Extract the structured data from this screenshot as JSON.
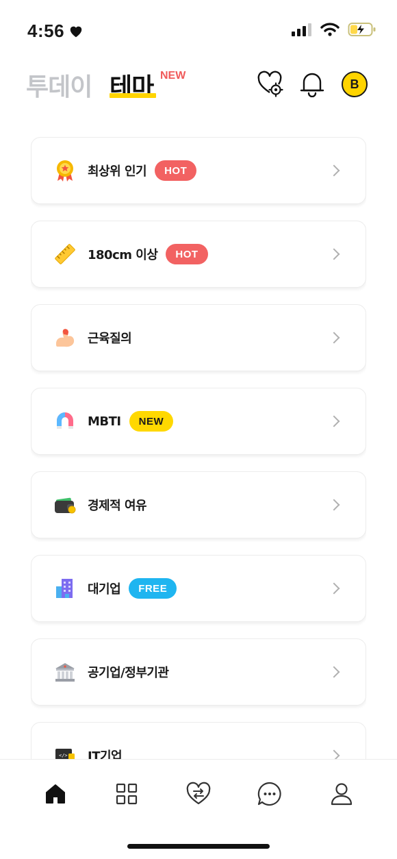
{
  "status_bar": {
    "time": "4:56"
  },
  "header": {
    "tab_today": "투데이",
    "tab_theme": "테마",
    "tab_theme_badge": "NEW",
    "avatar_letter": "B"
  },
  "themes": [
    {
      "label": "최상위 인기",
      "badge": "HOT",
      "badge_type": "hot",
      "icon": "medal-icon"
    },
    {
      "label": "180cm 이상",
      "badge": "HOT",
      "badge_type": "hot",
      "icon": "ruler-icon"
    },
    {
      "label": "근육질의",
      "badge": "",
      "badge_type": "",
      "icon": "flexed-arm-icon"
    },
    {
      "label": "MBTI",
      "badge": "NEW",
      "badge_type": "new",
      "icon": "magnet-icon"
    },
    {
      "label": "경제적 여유",
      "badge": "",
      "badge_type": "",
      "icon": "wallet-icon"
    },
    {
      "label": "대기업",
      "badge": "FREE",
      "badge_type": "free",
      "icon": "office-building-icon"
    },
    {
      "label": "공기업/정부기관",
      "badge": "",
      "badge_type": "",
      "icon": "government-building-icon"
    },
    {
      "label": "IT기업",
      "badge": "",
      "badge_type": "",
      "icon": "laptop-code-icon"
    }
  ],
  "colors": {
    "accent_yellow": "#ffd400",
    "hot_red": "#f26262",
    "free_blue": "#1fb5f0"
  },
  "bottom_nav": [
    {
      "name": "home",
      "icon": "home-icon",
      "active": true
    },
    {
      "name": "grid",
      "icon": "grid-icon",
      "active": false
    },
    {
      "name": "exchange",
      "icon": "heart-exchange-icon",
      "active": false
    },
    {
      "name": "chat",
      "icon": "chat-bubble-icon",
      "active": false
    },
    {
      "name": "profile",
      "icon": "person-icon",
      "active": false
    }
  ]
}
